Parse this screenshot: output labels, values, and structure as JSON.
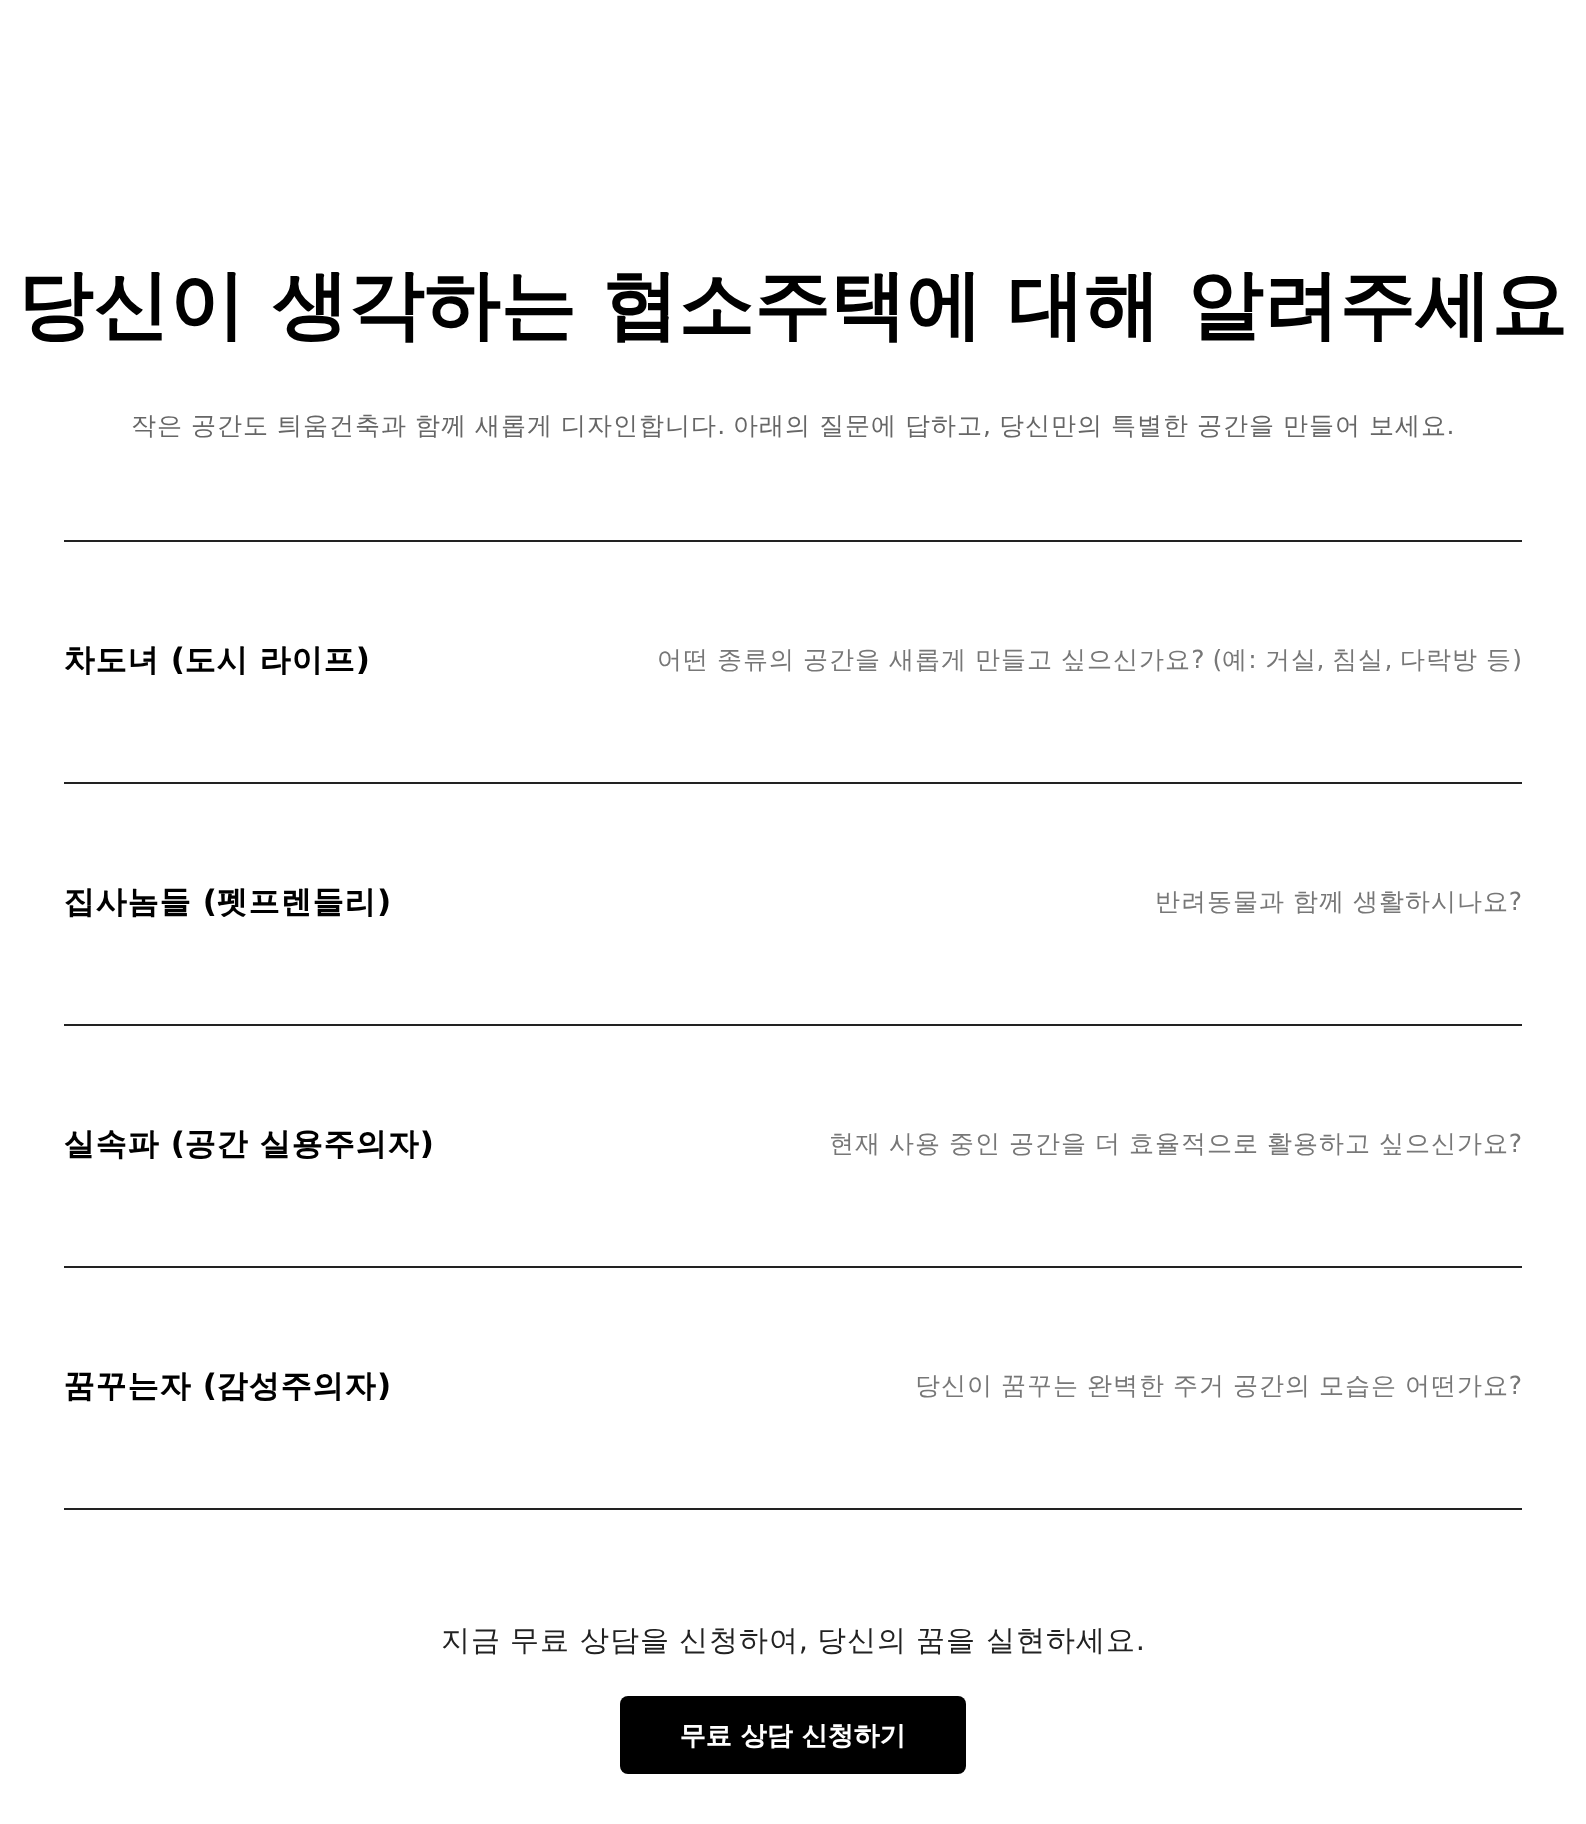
{
  "header": {
    "title": "당신이 생각하는 협소주택에 대해 알려주세요",
    "subtitle": "작은 공간도 틔움건축과 함께 새롭게 디자인합니다. 아래의 질문에 답하고, 당신만의 특별한 공간을 만들어 보세요."
  },
  "questions": [
    {
      "label": "차도녀 (도시 라이프)",
      "question": "어떤 종류의 공간을 새롭게 만들고 싶으신가요? (예: 거실, 침실, 다락방 등)"
    },
    {
      "label": "집사놈들 (펫프렌들리)",
      "question": "반려동물과 함께 생활하시나요?"
    },
    {
      "label": "실속파 (공간 실용주의자)",
      "question": "현재 사용 중인 공간을 더 효율적으로 활용하고 싶으신가요?"
    },
    {
      "label": "꿈꾸는자 (감성주의자)",
      "question": "당신이 꿈꾸는 완벽한 주거 공간의 모습은 어떤가요?"
    }
  ],
  "cta": {
    "text": "지금 무료 상담을 신청하여, 당신의 꿈을 실현하세요.",
    "button": "무료 상담 신청하기"
  }
}
